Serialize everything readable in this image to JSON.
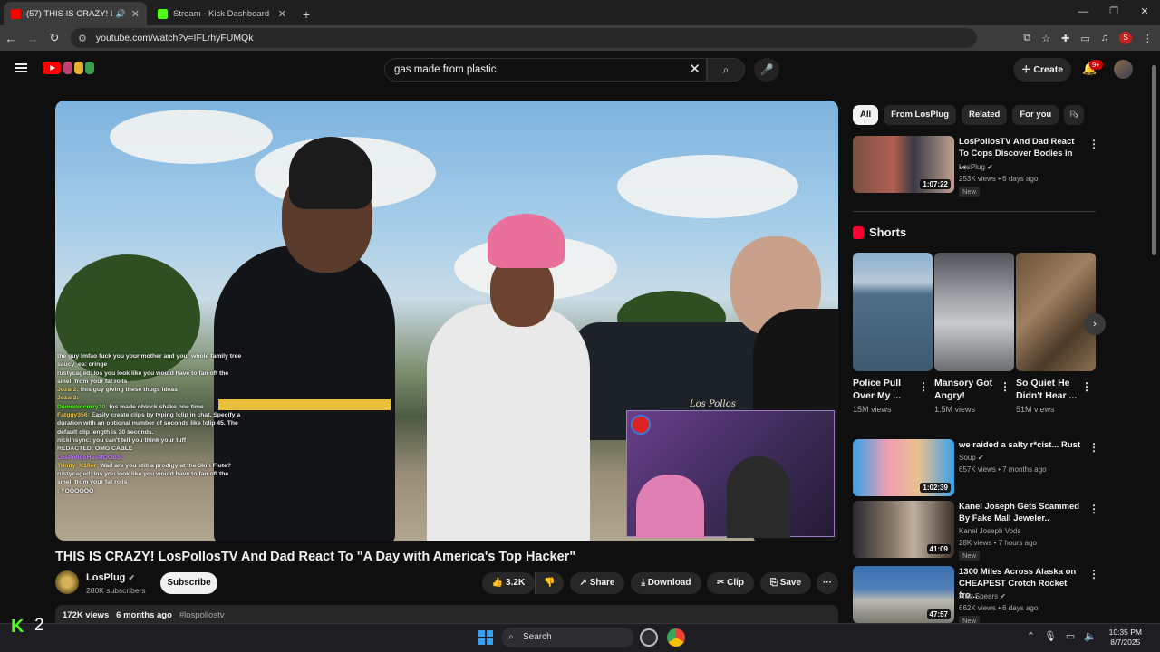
{
  "browser": {
    "tabs": [
      {
        "title": "(57) THIS IS CRAZY! LosPollo",
        "close": "✕"
      },
      {
        "title": "Stream - Kick Dashboard",
        "close": "✕"
      }
    ],
    "new_tab": "+",
    "url": "youtube.com/watch?v=IFLrhyFUMQk",
    "profile": "S"
  },
  "youtube": {
    "search_query": "gas made from plastic",
    "create_label": "Create",
    "notif_badge": "9+"
  },
  "video": {
    "title": "THIS IS CRAZY! LosPollosTV And Dad React To \"A Day with America's Top Hacker\"",
    "channel": "LosPlug",
    "subscribers": "280K subscribers",
    "subscribe_label": "Subscribe",
    "likes": "3.2K",
    "share_label": "Share",
    "download_label": "Download",
    "clip_label": "Clip",
    "save_label": "Save",
    "views": "172K views",
    "age": "6 months ago",
    "hashtag": "#lospollostv",
    "signature": "Los Pollos"
  },
  "chat_overlay": [
    {
      "user": "",
      "text": "the guy lmfao fuck you your mother and your whole family tree",
      "color": "#f0f0f0"
    },
    {
      "user": "saucy_ea:",
      "text": "cringe",
      "color": "#e6e6e6"
    },
    {
      "user": "rustycaged:",
      "text": "los you look like you would have to fan off the smell from your fat rolls",
      "color": "#e6e6e6"
    },
    {
      "user": "Jozar2:",
      "text": "this guy giving these thugs ideas",
      "color": "#f2c94c"
    },
    {
      "user": "Jozar2:",
      "text": "",
      "color": "#f2c94c"
    },
    {
      "user": "Demoniccurry30:",
      "text": "los made oblock shake one time",
      "color": "#53fc18"
    },
    {
      "user": "Fatguy356:",
      "text": "Easily create clips by typing !clip in chat. Specify a duration with an optional number of seconds like !clip 45. The default clip length is 30 seconds.",
      "color": "#f2c94c"
    },
    {
      "user": "nickinsync:",
      "text": "you can't tell you think your tuff",
      "color": "#e6e6e6"
    },
    {
      "user": "REDACTED:",
      "text": "OMG CABLE",
      "color": "#e6e6e6"
    },
    {
      "user": "LosPollosHasMOOBS:",
      "text": "",
      "color": "#c77dff"
    },
    {
      "user": "Trinity_K1ller:",
      "text": "Wad are you still a prodigy at the Skin Flute?",
      "color": "#f2c94c"
    },
    {
      "user": "rustycaged:",
      "text": "los you look like you would have to fan off the smell from your fat rolls",
      "color": "#e6e6e6"
    },
    {
      "user": "",
      "text": ": YOOOOOO",
      "color": "#e6e6e6"
    }
  ],
  "sidebar": {
    "chips": [
      "All",
      "From LosPlug",
      "Related",
      "For you",
      "R"
    ],
    "top_video": {
      "title": "LosPollosTV And Dad React To Cops Discover Bodies in ...",
      "channel": "LosPlug",
      "meta": "253K views • 6 days ago",
      "badge": "New",
      "duration": "1:07:22"
    },
    "shorts_header": "Shorts",
    "shorts": [
      {
        "title": "Police Pull Over My ...",
        "views": "15M views"
      },
      {
        "title": "Mansory Got Angry!",
        "views": "1.5M views"
      },
      {
        "title": "So Quiet He Didn't Hear ...",
        "views": "51M views"
      }
    ],
    "videos": [
      {
        "title": "we raided a salty r*cist... Rust",
        "channel": "Soup",
        "meta": "657K views • 7 months ago",
        "badge": "",
        "duration": "1:02:39"
      },
      {
        "title": "Kanel Joseph Gets Scammed By Fake Mall Jeweler..",
        "channel": "Kanel Joseph Vods",
        "meta": "28K views • 7 hours ago",
        "badge": "New",
        "duration": "41:09"
      },
      {
        "title": "1300 Miles Across Alaska on CHEAPEST Crotch Rocket fro...",
        "channel": "Matt Spears",
        "meta": "662K views • 6 days ago",
        "badge": "New",
        "duration": "47:57"
      }
    ]
  },
  "taskbar": {
    "kick_count": "2",
    "search_label": "Search",
    "time": "10:35 PM",
    "date": "8/7/2025"
  },
  "colors": {
    "accent": "#ff0000",
    "kick": "#53fc18"
  }
}
